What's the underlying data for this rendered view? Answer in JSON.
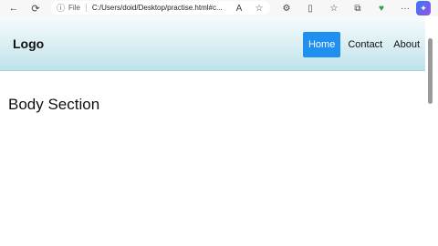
{
  "browser": {
    "back_icon": "←",
    "refresh_icon": "⟳",
    "info_icon": "ⓘ",
    "scheme_label": "File",
    "url": "C:/Users/doid/Desktop/practise.html#c...",
    "read_aloud_icon": "A",
    "favorite_icon": "☆",
    "extensions_icon": "⚙",
    "split_icon": "▯",
    "favorites_bar_icon": "☆",
    "collections_icon": "⧉",
    "browser_essentials_icon": "♥",
    "more_icon": "···",
    "copilot_icon": "✦"
  },
  "site": {
    "logo": "Logo",
    "nav": [
      {
        "label": "Home",
        "active": true
      },
      {
        "label": "Contact",
        "active": false
      },
      {
        "label": "About",
        "active": false
      }
    ],
    "body_title": "Body Section"
  },
  "colors": {
    "accent": "#1f8ff0",
    "header_top": "#f6fbfc",
    "header_bottom": "#bfe1e9"
  }
}
